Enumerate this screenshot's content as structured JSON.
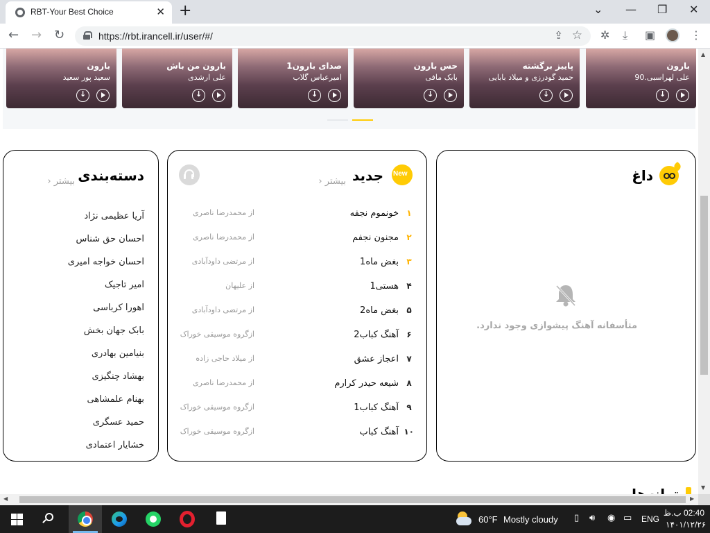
{
  "browser": {
    "tab_title": "RBT-Your Best Choice",
    "tab_close": "✕",
    "new_tab": "+",
    "url": "https://rbt.irancell.ir/user/#/",
    "window": {
      "dropdown": "⌄",
      "minimize": "—",
      "restore": "❐",
      "close": "✕"
    },
    "nav": {
      "back": "←",
      "forward": "→",
      "reload": "↻"
    },
    "icons": {
      "share": "⇪",
      "star": "☆",
      "extensions": "✲",
      "download": "⤓",
      "sidepanel": "▣",
      "menu": "⋮"
    }
  },
  "carousel": {
    "cards": [
      {
        "song": "بارون",
        "artist": "علی لهراسبی.90"
      },
      {
        "song": "پاییز برگشته",
        "artist": "حمید گودرزی و میلاد بابایی"
      },
      {
        "song": "حس بارون",
        "artist": "بابک مافی"
      },
      {
        "song": "صدای بارون1",
        "artist": "امیرعباس گلاب"
      },
      {
        "song": "بارون من باش",
        "artist": "علی ارشدی"
      },
      {
        "song": "بارون",
        "artist": "سعید پور سعید"
      }
    ],
    "active_dot_color": "#ffcb05",
    "inactive_dot_color": "#e6e9ec"
  },
  "daagh": {
    "title": "داغ",
    "empty_message": "متأسفانه آهنگ پیشوازی وجود ندارد."
  },
  "jadid": {
    "title": "جدید",
    "more": "بیشتر",
    "badge": "New",
    "items": [
      {
        "num": "۱",
        "song": "خونموم نجفه",
        "by": "از محمدرضا ناصری"
      },
      {
        "num": "۲",
        "song": "مجنون نجفم",
        "by": "از محمدرضا ناصری"
      },
      {
        "num": "۳",
        "song": "بغض ماه1",
        "by": "از مرتضی داودآبادی"
      },
      {
        "num": "۴",
        "song": "هستی1",
        "by": "از علیهان"
      },
      {
        "num": "۵",
        "song": "بغض ماه2",
        "by": "از مرتضی داودآبادی"
      },
      {
        "num": "۶",
        "song": "آهنگ کباب2",
        "by": "ازگروه موسیقی خوراک"
      },
      {
        "num": "۷",
        "song": "اعجاز عشق",
        "by": "از میلاد حاجی زاده"
      },
      {
        "num": "۸",
        "song": "شیعه حیدر کرارم",
        "by": "از محمدرضا ناصری"
      },
      {
        "num": "۹",
        "song": "آهنگ کباب1",
        "by": "ازگروه موسیقی خوراک"
      },
      {
        "num": "۱۰",
        "song": "آهنگ کباب",
        "by": "ازگروه موسیقی خوراک"
      }
    ]
  },
  "categories": {
    "title": "دسته‌بندی",
    "more": "بیشتر",
    "items": [
      "آریا عظیمی نژاد",
      "احسان حق شناس",
      "احسان خواجه امیری",
      "امیر تاجیک",
      "اهورا کرباسی",
      "بابک جهان بخش",
      "بنیامین بهادری",
      "بهشاد چنگیزی",
      "بهنام علمشاهی",
      "حمید عسگری",
      "خشایار اعتمادی"
    ]
  },
  "next_section_heading": "ترانه‌ها",
  "taskbar": {
    "weather_temp": "60°F",
    "weather_desc": "Mostly cloudy",
    "lang": "ENG",
    "time": "02:40 ب.ظ",
    "date": "۱۴۰۱/۱۲/۲۶"
  },
  "colors": {
    "accent": "#ffcb05",
    "text": "#000000",
    "muted": "#a0a0a0"
  }
}
